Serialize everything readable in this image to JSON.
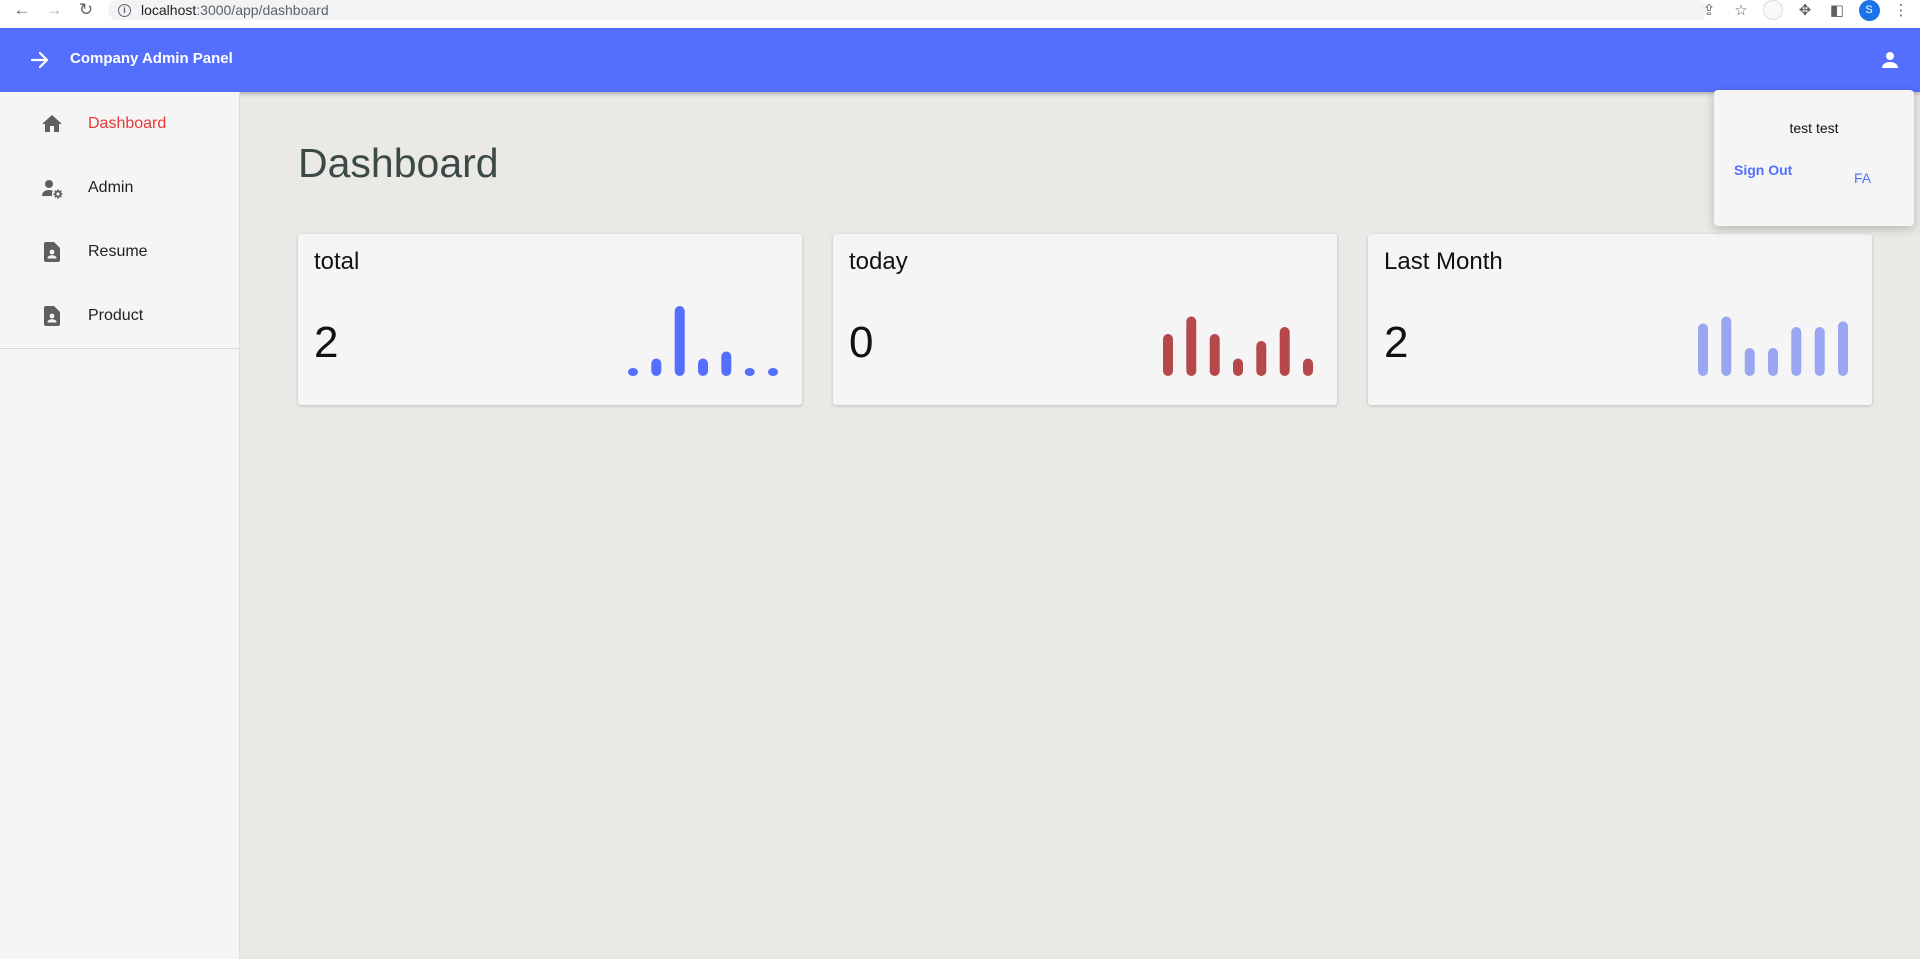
{
  "browser": {
    "url_host": "localhost",
    "url_path": ":3000/app/dashboard",
    "profile_initial": "S"
  },
  "header": {
    "title": "Company Admin Panel",
    "color": "#546ffe"
  },
  "sidebar": {
    "items": [
      {
        "label": "Dashboard",
        "icon": "home-icon",
        "active": true
      },
      {
        "label": "Admin",
        "icon": "user-cog-icon",
        "active": false
      },
      {
        "label": "Resume",
        "icon": "document-person-icon",
        "active": false
      },
      {
        "label": "Product",
        "icon": "document-person-icon",
        "active": false
      }
    ]
  },
  "main": {
    "title": "Dashboard",
    "cards": [
      {
        "title": "total",
        "value": "2",
        "color": "#546ffe"
      },
      {
        "title": "today",
        "value": "0",
        "color": "#b5484b"
      },
      {
        "title": "Last Month",
        "value": "2",
        "color": "#9aa6f2"
      }
    ]
  },
  "chart_data": [
    {
      "type": "bar",
      "values": [
        0.1,
        0.25,
        1.0,
        0.25,
        0.35,
        0.1,
        0.1
      ]
    },
    {
      "type": "bar",
      "values": [
        0.6,
        0.85,
        0.6,
        0.25,
        0.5,
        0.7,
        0.25
      ]
    },
    {
      "type": "bar",
      "values": [
        0.75,
        0.85,
        0.4,
        0.4,
        0.7,
        0.7,
        0.78
      ]
    }
  ],
  "user_menu": {
    "name": "test test",
    "sign_out": "Sign Out",
    "language": "FA"
  }
}
